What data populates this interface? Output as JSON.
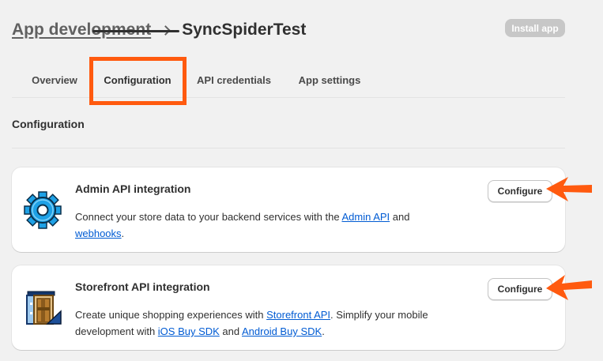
{
  "breadcrumb": {
    "parent": "App development",
    "title": "SyncSpiderTest"
  },
  "header": {
    "install_label": "Install app"
  },
  "tabs": [
    {
      "label": "Overview"
    },
    {
      "label": "Configuration"
    },
    {
      "label": "API credentials"
    },
    {
      "label": "App settings"
    }
  ],
  "active_tab": "Configuration",
  "section": {
    "title": "Configuration"
  },
  "cards": [
    {
      "title": "Admin API integration",
      "desc_1": "Connect your store data to your backend services with the ",
      "link_1": "Admin API",
      "desc_2": " and ",
      "link_2": "webhooks",
      "desc_3": ".",
      "button": "Configure",
      "icon": "gear-icon"
    },
    {
      "title": "Storefront API integration",
      "desc_1": "Create unique shopping experiences with ",
      "link_1": "Storefront API",
      "desc_2": ". Simplify your mobile development with ",
      "link_2": "iOS Buy SDK",
      "desc_3": " and ",
      "link_3": "Android Buy SDK",
      "desc_4": ".",
      "button": "Configure",
      "icon": "storefront-icon"
    }
  ],
  "colors": {
    "annotation": "#ff5a0f",
    "link": "#005bd3",
    "icon_blue": "#1ea1e6"
  }
}
